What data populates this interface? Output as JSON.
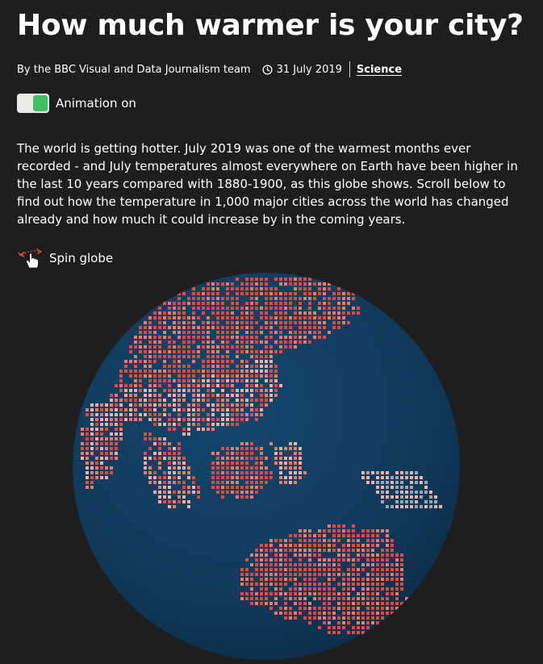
{
  "article": {
    "headline": "How much warmer is your city?",
    "byline": "By the BBC Visual and Data Journalism team",
    "date": "31 July 2019",
    "topic": "Science",
    "intro": "The world is getting hotter. July 2019 was one of the warmest months ever recorded - and July temperatures almost everywhere on Earth have been higher in the last 10 years compared with 1880-1900, as this globe shows. Scroll below to find out how the temperature in 1,000 major cities across the world has changed already and how much it could increase by in the coming years."
  },
  "controls": {
    "animation_label": "Animation on",
    "animation_enabled": true,
    "spin_label": "Spin globe"
  },
  "icons": {
    "clock": "clock-icon",
    "spin": "hand-drag-icon"
  },
  "colors": {
    "background": "#1e1e1e",
    "ocean": "#0f3a5c",
    "toggle_on": "#3fbf5f",
    "warm_high": "#e8473a",
    "warm_mid": "#f07a66",
    "warm_low": "#f4b0a2",
    "neutral": "#9aa7b0"
  }
}
